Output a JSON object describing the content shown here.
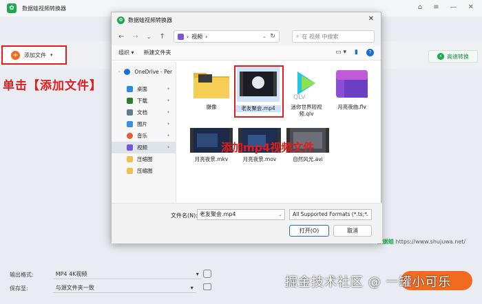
{
  "app": {
    "title": "数据蛙视频转换器",
    "logo": "frog-logo-icon",
    "window_controls": [
      "⌂",
      "≡",
      "—",
      "✕"
    ]
  },
  "toolbar": {
    "add_file_label": "添加文件",
    "fast_convert_label": "高速转换",
    "add_plus": "+",
    "add_caret": "▾",
    "fast_bolt": "⚡"
  },
  "annotations": {
    "click_add": "单击【添加文件】",
    "add_mp4": "添加mp4视频文件",
    "accent_color": "#e11d1d"
  },
  "bottom": {
    "format_label": "输出格式:",
    "format_value": "MP4 4K视频",
    "save_label": "保存至:",
    "save_value": "与源文件夹一致",
    "caret": "▾",
    "convert_color": "#f26b20"
  },
  "watermarks": {
    "juejin": "掘金技术社区 @ 一罐小可乐",
    "site_name": "数据蛙",
    "site_url": "https://www.shujuwa.net/"
  },
  "dialog": {
    "title": "数据蛙视频转换器",
    "close": "✕",
    "nav": {
      "back": "←",
      "forward": "→",
      "down": "⌄",
      "up": "↑"
    },
    "address": {
      "crumb": "视频",
      "sep": "›",
      "dropdown": "⌄",
      "refresh": "↻"
    },
    "search_placeholder": "在 视频 中搜索",
    "search_icon": "⌕",
    "organize": "组织 ▾",
    "new_folder": "新建文件夹",
    "view_icons": [
      "▭ ▾",
      "▮"
    ],
    "help_icon": "?",
    "nav_pane": [
      {
        "label": "OneDrive - Per",
        "icon": "cloud-icon",
        "color": "#1b6fd1"
      },
      {
        "label": "桌面",
        "icon": "desktop-icon",
        "color": "#2b8ae6",
        "pin": "📌"
      },
      {
        "label": "下载",
        "icon": "download-icon",
        "color": "#2e7d32",
        "pin": "📌"
      },
      {
        "label": "文档",
        "icon": "document-icon",
        "color": "#607d8b",
        "pin": "📌"
      },
      {
        "label": "图片",
        "icon": "picture-icon",
        "color": "#3f8fd8",
        "pin": "📌"
      },
      {
        "label": "音乐",
        "icon": "music-icon",
        "color": "#e65c3a",
        "pin": "📌"
      },
      {
        "label": "视频",
        "icon": "video-icon",
        "color": "#7b55d6",
        "pin": "📌"
      },
      {
        "label": "压缩图",
        "icon": "folder-icon",
        "color": "#f0c24b"
      },
      {
        "label": "压缩图",
        "icon": "folder-icon",
        "color": "#f0c24b"
      }
    ],
    "files": [
      {
        "name": "摄像",
        "kind": "folder"
      },
      {
        "name": "老友聚会.mp4",
        "kind": "video-selected"
      },
      {
        "name": "迷你世界短视频.qlv",
        "kind": "qlv"
      },
      {
        "name": "月亮夜曲.flv",
        "kind": "flv"
      },
      {
        "name": "月亮夜景.mkv",
        "kind": "video"
      },
      {
        "name": "月亮夜景.mov",
        "kind": "video"
      },
      {
        "name": "自然风光.avi",
        "kind": "video"
      }
    ],
    "filename_label": "文件名(N):",
    "filename_value": "老友聚会.mp4",
    "filter_value": "All Supported Formats (*.ts;*",
    "open_label": "打开(O)",
    "cancel_label": "取消",
    "dropdown": "⌄"
  }
}
